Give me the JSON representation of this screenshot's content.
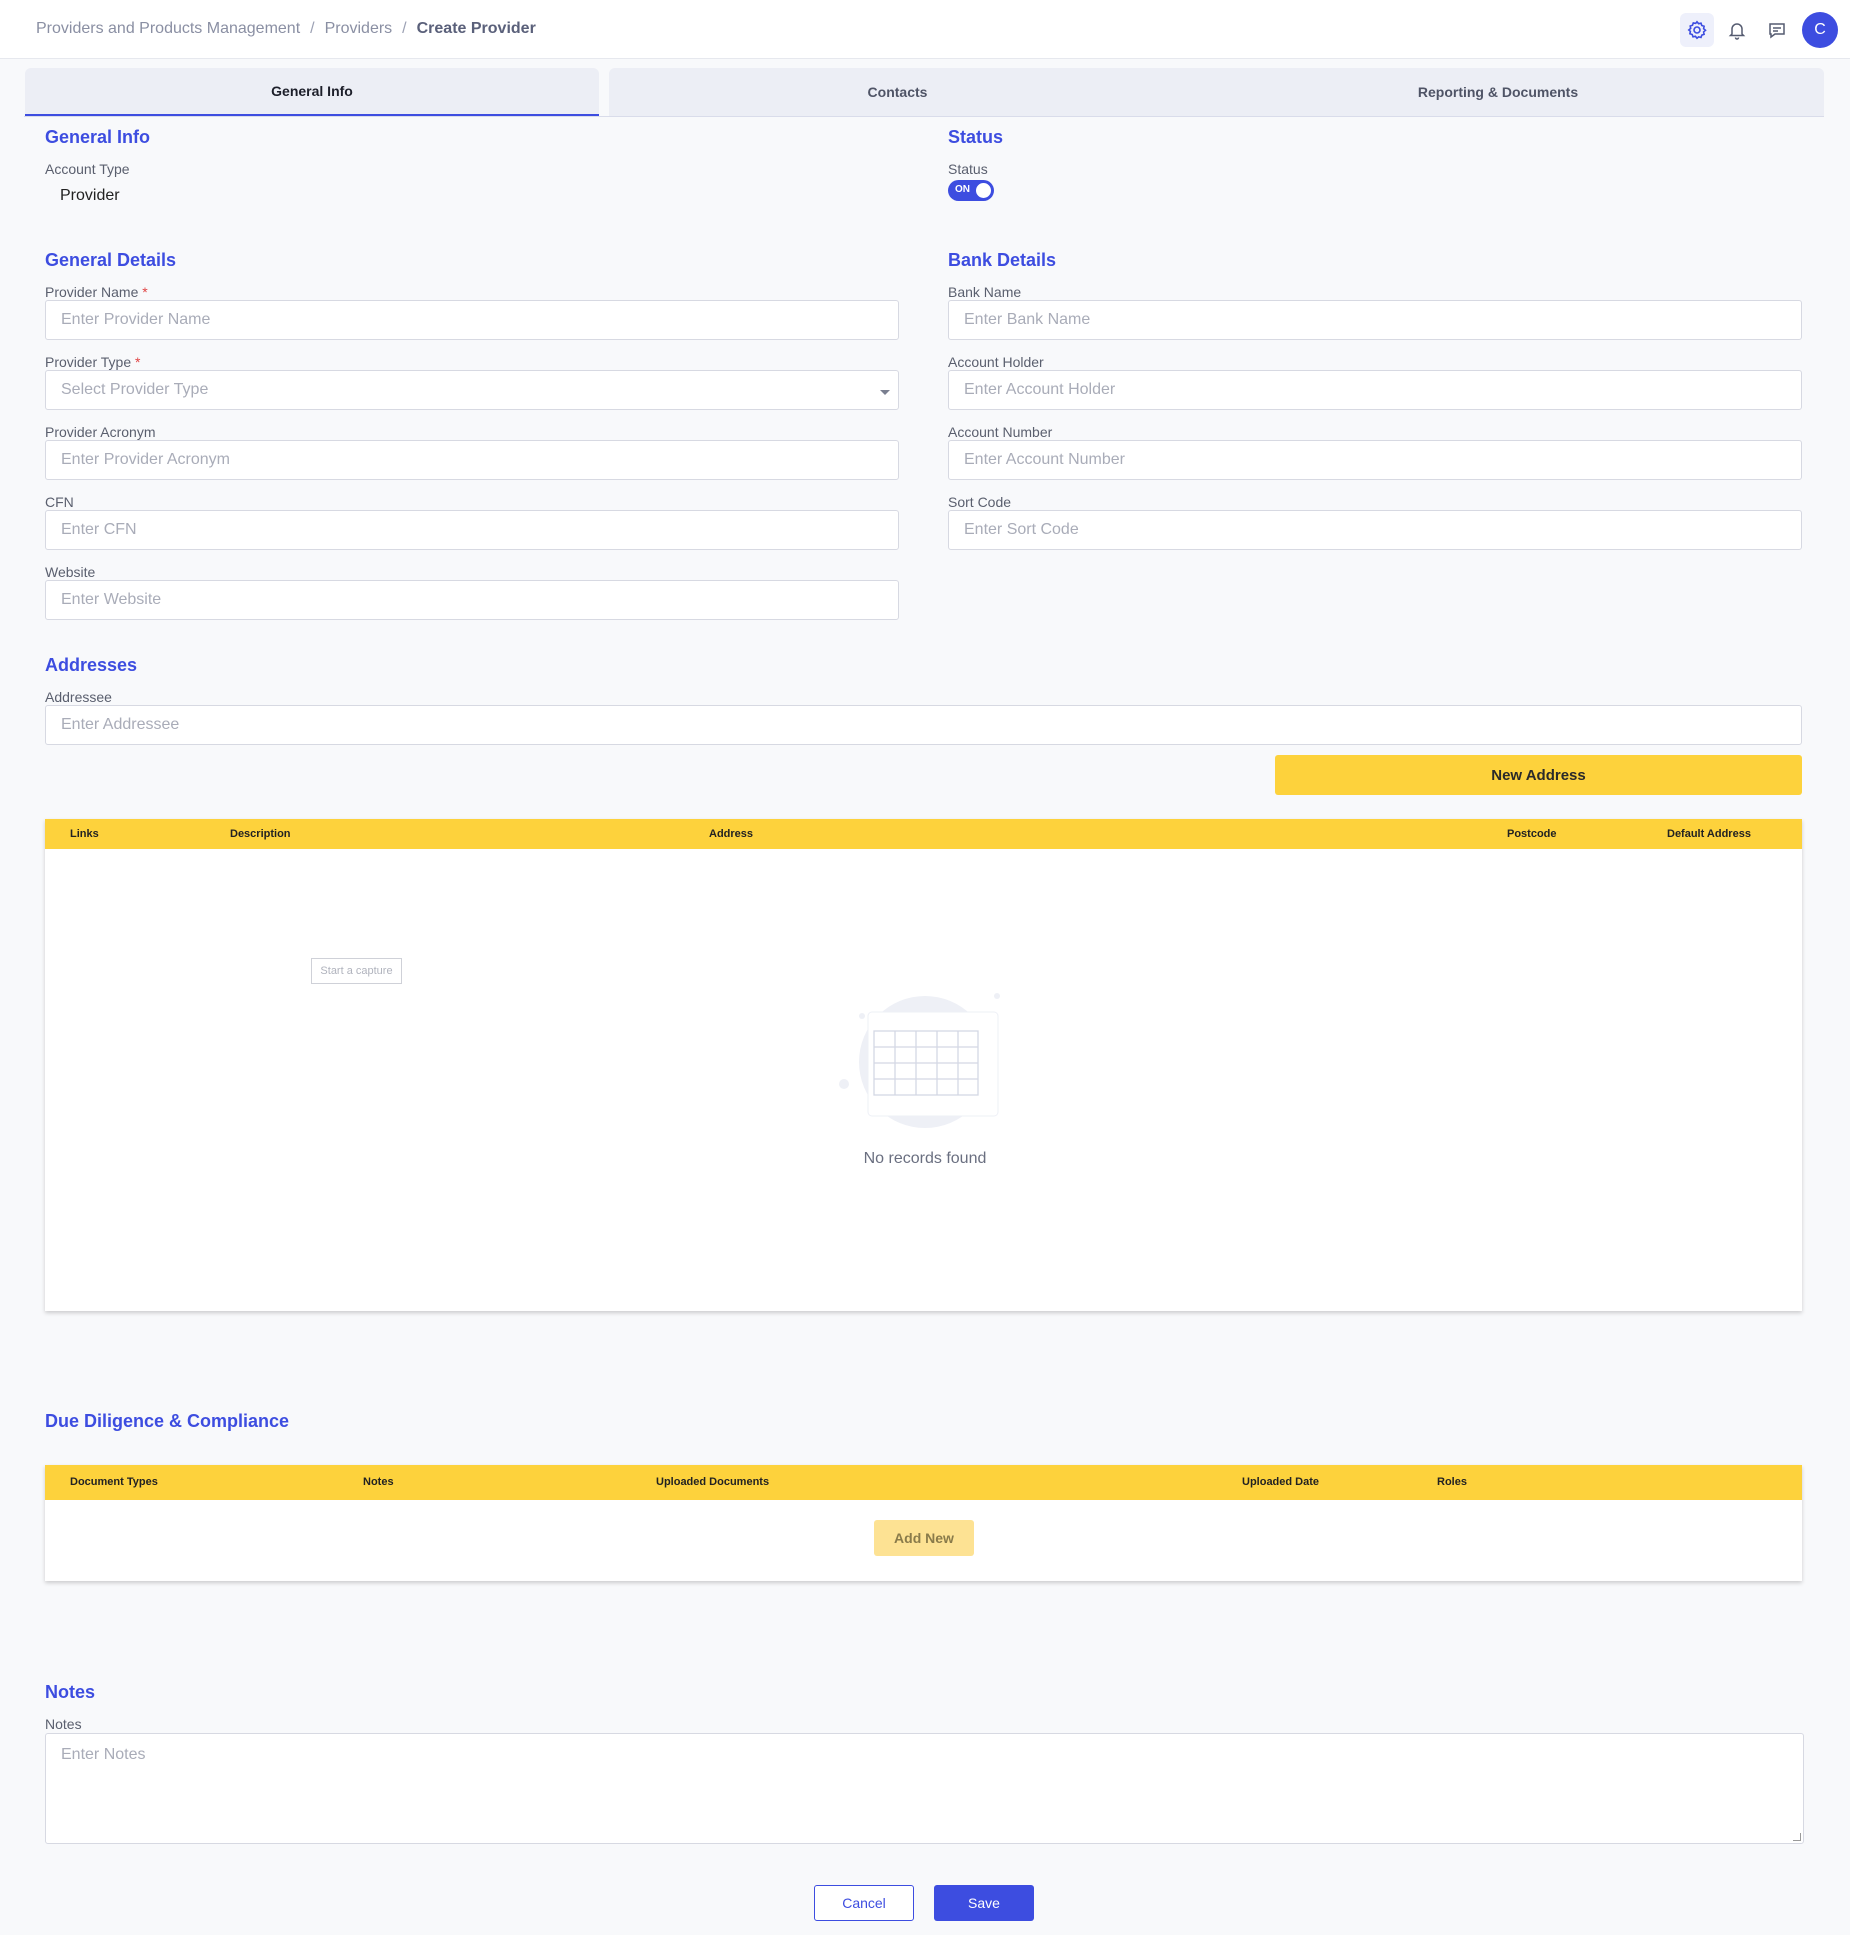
{
  "breadcrumb": {
    "items": [
      "Providers and Products Management",
      "Providers"
    ],
    "separator": "/",
    "current": "Create Provider"
  },
  "header": {
    "avatar_initial": "C",
    "icons": [
      "settings-icon",
      "bell-icon",
      "message-icon"
    ]
  },
  "tabs": [
    {
      "label": "General Info",
      "active": true
    },
    {
      "label": "Contacts",
      "active": false
    },
    {
      "label": "Reporting & Documents",
      "active": false
    }
  ],
  "general_info": {
    "title": "General Info",
    "account_type_label": "Account Type",
    "account_type_value": "Provider"
  },
  "status": {
    "title": "Status",
    "label": "Status",
    "toggle_text": "ON",
    "on": true
  },
  "general_details": {
    "title": "General Details",
    "fields": {
      "provider_name": {
        "label": "Provider Name",
        "required": "*",
        "placeholder": "Enter Provider Name"
      },
      "provider_type": {
        "label": "Provider Type",
        "required": "*",
        "placeholder": "Select Provider Type"
      },
      "provider_acronym": {
        "label": "Provider Acronym",
        "placeholder": "Enter Provider Acronym"
      },
      "cfn": {
        "label": "CFN",
        "placeholder": "Enter CFN"
      },
      "website": {
        "label": "Website",
        "placeholder": "Enter Website"
      }
    }
  },
  "bank_details": {
    "title": "Bank Details",
    "fields": {
      "bank_name": {
        "label": "Bank Name",
        "placeholder": "Enter Bank Name"
      },
      "account_holder": {
        "label": "Account Holder",
        "placeholder": "Enter Account Holder"
      },
      "account_number": {
        "label": "Account Number",
        "placeholder": "Enter Account Number"
      },
      "sort_code": {
        "label": "Sort Code",
        "placeholder": "Enter Sort Code"
      }
    }
  },
  "addresses": {
    "title": "Addresses",
    "addressee_label": "Addressee",
    "addressee_placeholder": "Enter Addressee",
    "new_address_button": "New Address",
    "columns": [
      "Links",
      "Description",
      "Address",
      "Postcode",
      "Default Address"
    ],
    "capture_tag": "Start a capture",
    "empty_text": "No records found"
  },
  "due_diligence": {
    "title": "Due Diligence & Compliance",
    "columns": [
      "Document Types",
      "Notes",
      "Uploaded Documents",
      "Uploaded Date",
      "Roles"
    ],
    "add_new_button": "Add New"
  },
  "notes": {
    "title": "Notes",
    "label": "Notes",
    "placeholder": "Enter Notes"
  },
  "footer": {
    "cancel_button": "Cancel",
    "save_button": "Save"
  },
  "colors": {
    "accent": "#3d4de0",
    "table_header": "#fdd23c",
    "required": "#e04545"
  }
}
